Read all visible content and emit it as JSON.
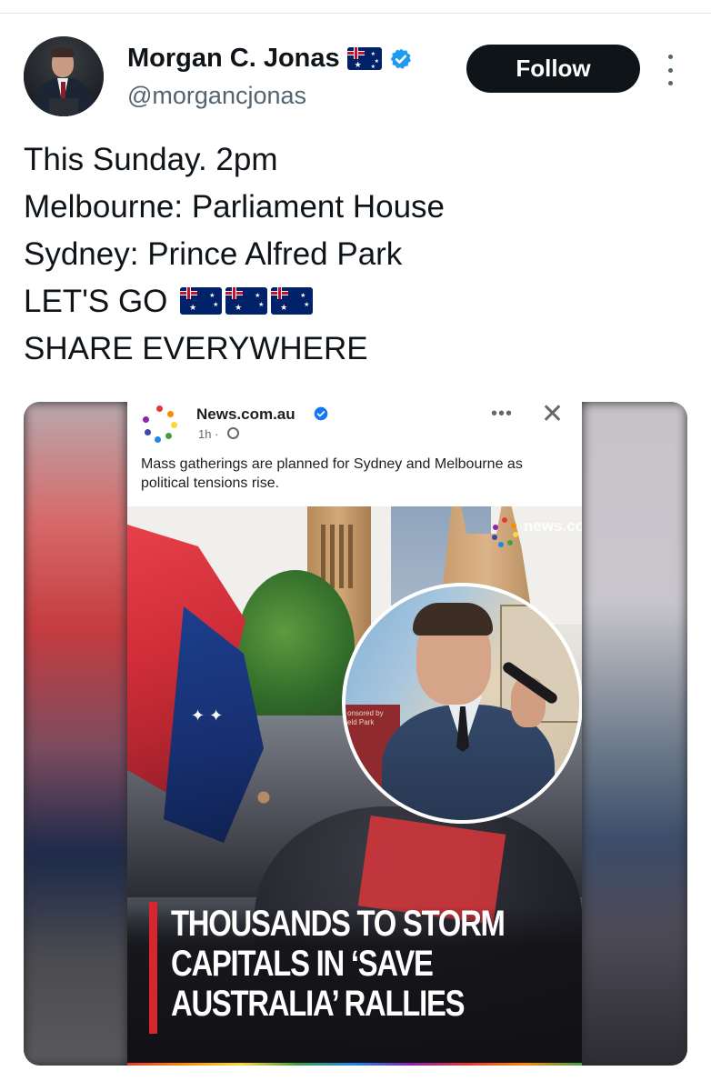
{
  "tweet": {
    "author_name": "Morgan C. Jonas",
    "handle": "@morgancjonas",
    "follow_label": "Follow",
    "lines": [
      "This Sunday. 2pm",
      "Melbourne: Parliament House",
      "Sydney: Prince Alfred Park",
      "LET'S GO",
      "SHARE EVERYWHERE"
    ]
  },
  "embedded_post": {
    "page_name": "News.com.au",
    "time": "1h ·",
    "caption": "Mass gatherings are planned for Sydney and Melbourne as political tensions rise.",
    "watermark": "news.com.au",
    "inset_sign": "onsored by\neld Park",
    "headline": [
      "THOUSANDS TO STORM",
      "CAPITALS IN ‘SAVE",
      "AUSTRALIA’ RALLIES"
    ]
  },
  "icons": {
    "verified": "verified-badge-icon",
    "more": "more-vertical-icon",
    "flag": "australia-flag-icon",
    "globe": "globe-icon",
    "close": "close-icon"
  },
  "colors": {
    "follow_bg": "#0f1419",
    "verified_blue": "#1d9bf0",
    "headline_bar": "#d7262e",
    "handle_gray": "#536471"
  }
}
